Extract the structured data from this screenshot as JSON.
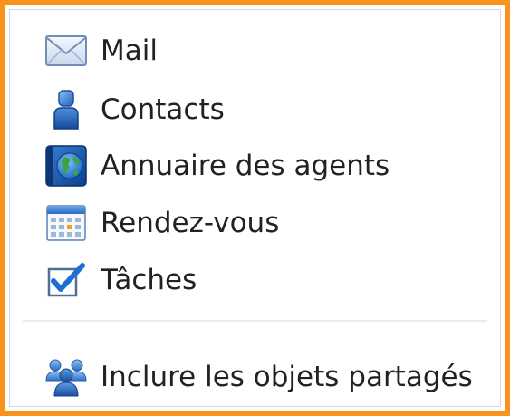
{
  "menu": {
    "items": [
      {
        "id": "mail",
        "label": "Mail",
        "icon": "envelope-icon"
      },
      {
        "id": "contacts",
        "label": "Contacts",
        "icon": "person-icon"
      },
      {
        "id": "directory",
        "label": "Annuaire des agents",
        "icon": "globe-book-icon"
      },
      {
        "id": "appointments",
        "label": "Rendez-vous",
        "icon": "calendar-icon"
      },
      {
        "id": "tasks",
        "label": "Tâches",
        "icon": "checkbox-icon"
      }
    ],
    "shared": {
      "label": "Inclure les objets partagés",
      "icon": "group-icon"
    }
  },
  "colors": {
    "frame_border": "#f7941d",
    "separator": "#ececec",
    "text": "#222222"
  }
}
